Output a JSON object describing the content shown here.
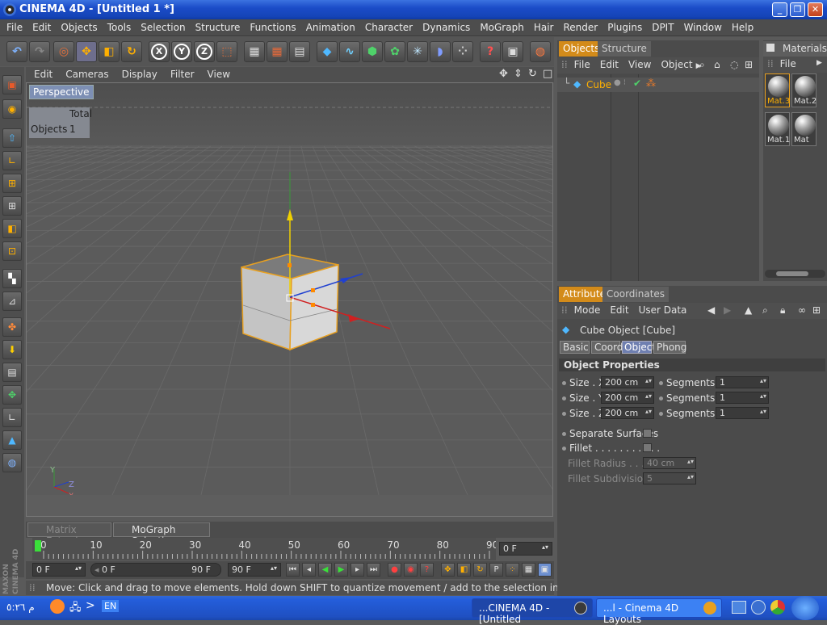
{
  "window": {
    "title": "CINEMA 4D - [Untitled 1 *]"
  },
  "menu": [
    "File",
    "Edit",
    "Objects",
    "Tools",
    "Selection",
    "Structure",
    "Functions",
    "Animation",
    "Character",
    "Dynamics",
    "MoGraph",
    "Hair",
    "Render",
    "Plugins",
    "DPIT",
    "Window",
    "Help"
  ],
  "toolbar_icons": [
    "undo-icon",
    "redo-icon",
    "live-selection-icon",
    "move-icon",
    "scale-icon",
    "rotate-icon",
    "x-axis-icon",
    "y-axis-icon",
    "z-axis-icon",
    "coordinate-system-icon",
    "render-view-icon",
    "render-picture-viewer-icon",
    "render-settings-icon",
    "cube-primitive-icon",
    "spline-icon",
    "nurbs-icon",
    "array-icon",
    "particle-icon",
    "deformer-icon",
    "mograph-icon",
    "help-icon",
    "scene-icon",
    "globe-icon"
  ],
  "toolbar_axes": [
    "X",
    "Y",
    "Z"
  ],
  "viewport": {
    "menu": [
      "Edit",
      "Cameras",
      "Display",
      "Filter",
      "View"
    ],
    "label": "Perspective",
    "hud_header": "Total",
    "hud_row_label": "Objects",
    "hud_row_value": "1"
  },
  "timeline": {
    "chips": [
      "Matrix Extrude",
      "MoGraph Selection"
    ],
    "ticks": [
      "0",
      "10",
      "20",
      "30",
      "40",
      "50",
      "60",
      "70",
      "80",
      "90"
    ],
    "current_frame": "0 F",
    "start_field": "0 F",
    "range_start": "0 F",
    "range_end": "90 F",
    "end_field": "90 F",
    "maxon_logo": "MAXON CINEMA 4D"
  },
  "status": "Move: Click and drag to move elements. Hold down SHIFT to quantize movement / add to the selection in point mode, CTRL to remo",
  "objects_panel": {
    "tabs": [
      "Objects",
      "Structure"
    ],
    "menu": [
      "File",
      "Edit",
      "View",
      "Object"
    ],
    "items": [
      {
        "name": "Cube"
      }
    ]
  },
  "materials_panel": {
    "title": "Materials",
    "menu": [
      "File"
    ],
    "materials": [
      "Mat.3",
      "Mat.2",
      "Mat.1",
      "Mat"
    ]
  },
  "attributes_panel": {
    "tabs": [
      "Attributes",
      "Coordinates"
    ],
    "menu": [
      "Mode",
      "Edit",
      "User Data"
    ],
    "object_title": "Cube Object [Cube]",
    "subtabs": [
      "Basic",
      "Coord.",
      "Object",
      "Phong"
    ],
    "active_subtab": "Object",
    "section": "Object Properties",
    "size": [
      {
        "label": "Size . X",
        "value": "200 cm"
      },
      {
        "label": "Size . Y",
        "value": "200 cm"
      },
      {
        "label": "Size . Z",
        "value": "200 cm"
      }
    ],
    "segments": [
      {
        "label": "Segments X",
        "value": "1"
      },
      {
        "label": "Segments Y",
        "value": "1"
      },
      {
        "label": "Segments Z",
        "value": "1"
      }
    ],
    "separate_surfaces": "Separate Surfaces",
    "fillet": "Fillet . . . . . . . . . . .",
    "fillet_radius_label": "Fillet Radius . . . . .",
    "fillet_radius_value": "40 cm",
    "fillet_subdivision_label": "Fillet Subdivision",
    "fillet_subdivision_value": "5"
  },
  "taskbar": {
    "clock": "م ٥:٢٦",
    "lang": "EN",
    "tasks": [
      "...CINEMA 4D - [Untitled",
      "...l - Cinema 4D Layouts"
    ]
  },
  "colors": {
    "accent": "#d38b1a",
    "titlebar": "#1f50c2",
    "panel": "#4b4b4b",
    "viewport_label": "#7d8fb4"
  }
}
